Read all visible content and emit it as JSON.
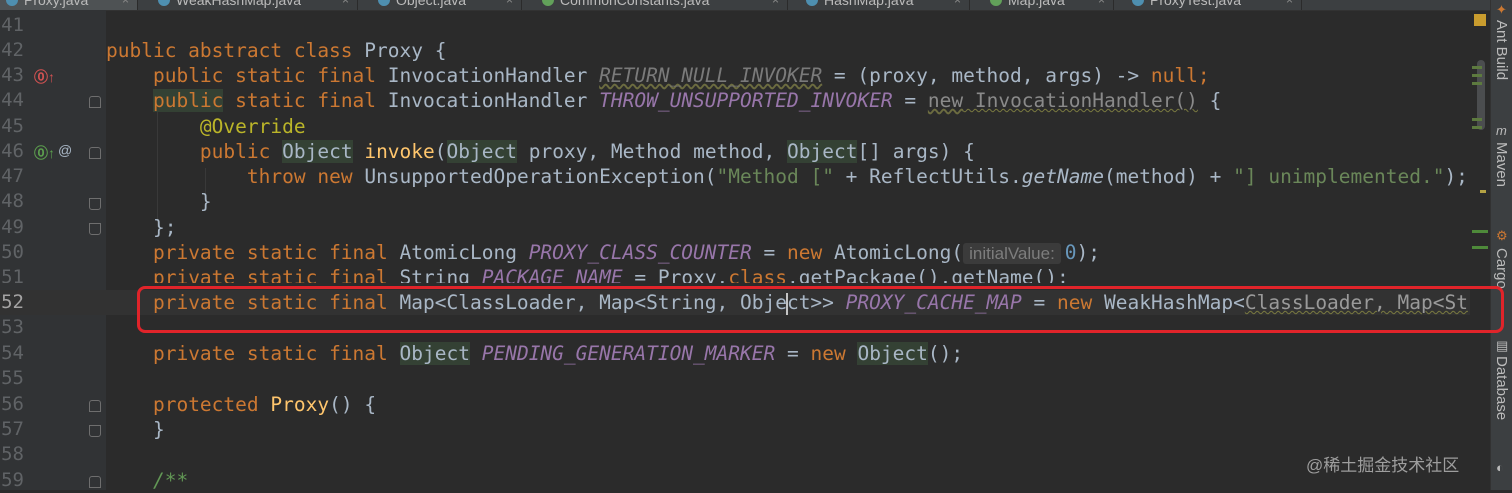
{
  "tabs": [
    {
      "label": "Proxy.java",
      "active": true,
      "icon": "class-icon"
    },
    {
      "label": "WeakHashMap.java",
      "icon": "class-icon"
    },
    {
      "label": "Object.java",
      "icon": "class-icon"
    },
    {
      "label": "CommonConstants.java",
      "icon": "interface-icon"
    },
    {
      "label": "HashMap.java",
      "icon": "class-icon"
    },
    {
      "label": "Map.java",
      "icon": "interface-icon"
    },
    {
      "label": "ProxyTest.java",
      "icon": "class-icon"
    }
  ],
  "tab_close": "×",
  "line_numbers": [
    "41",
    "42",
    "43",
    "44",
    "45",
    "46",
    "47",
    "48",
    "49",
    "50",
    "51",
    "52",
    "53",
    "54",
    "55",
    "56",
    "57",
    "58",
    "59"
  ],
  "current_line": "52",
  "code": {
    "l42": {
      "kw1": "public abstract class",
      "name": "Proxy",
      "rest": " {"
    },
    "l43": {
      "kw": "public static final",
      "type": "InvocationHandler",
      "field": "RETURN_NULL_INVOKER",
      "eq": " = (proxy, method, args) -> ",
      "nul": "null",
      "end": ";"
    },
    "l44": {
      "kw_pub": "public",
      "kw": " static final",
      "type": "InvocationHandler",
      "field": "THROW_UNSUPPORTED_INVOKER",
      "eq": " = ",
      "new": "new",
      "ctor": " InvocationHandler()",
      "end": " {"
    },
    "l45": {
      "annotation": "@Override"
    },
    "l46": {
      "kw": "public",
      "obj1": "Object",
      "method": "invoke",
      "p1": "(",
      "obj2": "Object",
      "p2": " proxy, Method method, ",
      "obj3": "Object",
      "p3": "[] args) {"
    },
    "l47": {
      "kw1": "throw",
      "kw2": "new",
      "cls": "UnsupportedOperationException(",
      "s1": "\"Method [\"",
      "plus1": " + ReflectUtils.",
      "call": "getName",
      "arg": "(method) + ",
      "s2": "\"] unimplemented.\"",
      "end": ");"
    },
    "l48": {
      "text": "}"
    },
    "l49": {
      "text": "};"
    },
    "l50": {
      "kw": "private static final",
      "type": "AtomicLong",
      "field": "PROXY_CLASS_COUNTER",
      "eq": " = ",
      "new": "new",
      "ctor": " AtomicLong(",
      "hint": "initialValue:",
      "num": "0",
      "end": ");"
    },
    "l51": {
      "kw": "private static final",
      "type": "String",
      "field": "PACKAGE_NAME",
      "eq": " = Proxy.",
      "cls_kw": "class",
      "rest": ".getPackage().getName();"
    },
    "l52": {
      "kw": "private static final",
      "type_a": "Map<ClassLoader, Map<String, Obje",
      "type_b": "ct>>",
      "field": "PROXY_CACHE_MAP",
      "eq": " = ",
      "new": "new",
      "ctor": " WeakHashMap<",
      "rhs": "ClassLoader, Map<St"
    },
    "l54": {
      "kw": "private static final",
      "obj": "Object",
      "field": "PENDING_GENERATION_MARKER",
      "eq": " = ",
      "new": "new",
      "obj2": "Object",
      "end": "();"
    },
    "l56": {
      "kw": "protected",
      "name": "Proxy",
      "end": "() {"
    },
    "l57": {
      "text": "}"
    },
    "l59": {
      "comment": "/**"
    }
  },
  "gutter_marks": {
    "l43": "override-up-icon",
    "l46a": "implements-up-icon",
    "l46b": "@"
  },
  "tool_windows": [
    "Ant Build",
    "Maven",
    "Cargo",
    "Database"
  ],
  "watermark": "@稀土掘金技术社区",
  "colors": {
    "keyword": "#cc7832",
    "field": "#9876aa",
    "string": "#6a8759",
    "annotation": "#bbb529",
    "method": "#ffc66d",
    "number": "#6897bb",
    "highlight_box": "#e0242a"
  }
}
